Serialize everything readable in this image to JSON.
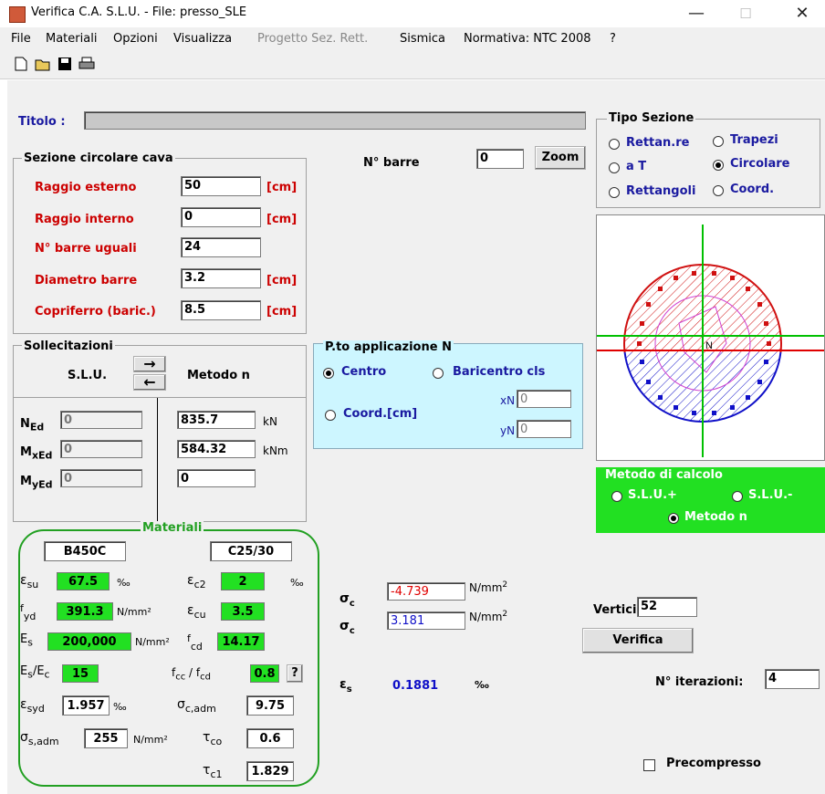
{
  "window": {
    "title": "Verifica C.A. S.L.U. - File: presso_SLE",
    "minimize": "—",
    "maximize": "☐",
    "close": "✕"
  },
  "menu": {
    "file": "File",
    "materiali": "Materiali",
    "opzioni": "Opzioni",
    "visualizza": "Visualizza",
    "progetto": "Progetto Sez. Rett.",
    "sismica": "Sismica",
    "normativa": "Normativa: NTC 2008",
    "help": "?"
  },
  "titolo": {
    "label": "Titolo :",
    "value": ""
  },
  "sezione": {
    "legend": "Sezione circolare cava",
    "raggio_est": {
      "label": "Raggio esterno",
      "value": "50",
      "unit": "[cm]"
    },
    "raggio_int": {
      "label": "Raggio interno",
      "value": "0",
      "unit": "[cm]"
    },
    "n_barre": {
      "label": "N° barre uguali",
      "value": "24"
    },
    "diametro": {
      "label": "Diametro barre",
      "value": "3.2",
      "unit": "[cm]"
    },
    "copriferro": {
      "label": "Copriferro (baric.)",
      "value": "8.5",
      "unit": "[cm]"
    }
  },
  "nbarre": {
    "label": "N° barre",
    "value": "0",
    "zoom": "Zoom"
  },
  "tipo": {
    "legend": "Tipo Sezione",
    "rettanre": "Rettan.re",
    "trapezi": "Trapezi",
    "at": "a T",
    "circolare": "Circolare",
    "rettangoli": "Rettangoli",
    "coord": "Coord."
  },
  "soll": {
    "legend": "Sollecitazioni",
    "slu": "S.L.U.",
    "metodo": "Metodo n",
    "arrow_r": "→",
    "arrow_l": "←",
    "ned": "0",
    "mxed": "0",
    "myed": "0",
    "n_val": "835.7",
    "n_unit": "kN",
    "mx_val": "584.32",
    "mx_unit": "kNm",
    "my_val": "0"
  },
  "papp": {
    "legend": "P.to applicazione N",
    "centro": "Centro",
    "baricentro": "Baricentro cls",
    "coord": "Coord.[cm]",
    "xn_label": "xN",
    "xn": "0",
    "yn_label": "yN",
    "yn": "0"
  },
  "metodo_calc": {
    "legend": "Metodo di calcolo",
    "slu_plus": "S.L.U.+",
    "slu_minus": "S.L.U.-",
    "metodo_n": "Metodo n"
  },
  "materiali": {
    "legend": "Materiali",
    "steel": "B450C",
    "concrete": "C25/30",
    "esu": "67.5",
    "ec2": "2",
    "fyd": "391.3",
    "ecu": "3.5",
    "es": "200,000",
    "fcd": "14.17",
    "ratio": "15",
    "fcc_fcd": "0.8",
    "esyd": "1.957",
    "sc_adm": "9.75",
    "ss_adm": "255",
    "tco": "0.6",
    "tc1": "1.829",
    "permil": "‰",
    "nmm2": "N/mm²",
    "q": "?"
  },
  "results": {
    "sc1": "-4.739",
    "sc2": "3.181",
    "es": "0.1881",
    "unit": "N/mm",
    "permil": "‰"
  },
  "vertici": {
    "label": "Vertici:",
    "value": "52"
  },
  "verifica": "Verifica",
  "iter": {
    "label": "N° iterazioni:",
    "value": "4"
  },
  "precompresso": "Precompresso",
  "colors": {
    "accent_green": "#22e022",
    "cyan_panel": "#cdf6ff",
    "red_zone": "#d01010",
    "blue_zone": "#1010c8"
  }
}
